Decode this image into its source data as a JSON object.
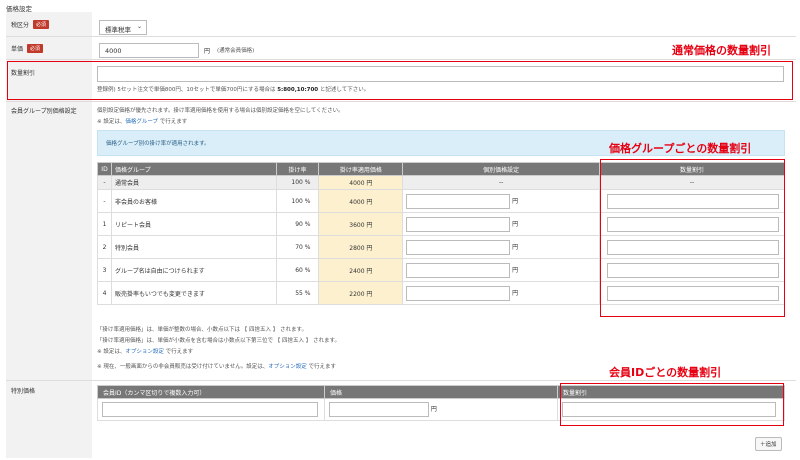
{
  "section_title": "価格設定",
  "tax": {
    "label": "税区分",
    "required": "必須",
    "value": "標準税率"
  },
  "price": {
    "label": "単価",
    "required": "必須",
    "value": "4000",
    "unit": "円",
    "note": "(通常会員価格)"
  },
  "qty": {
    "label": "数量割引",
    "hint_prefix": "登録例) 5セット注文で単価800円、10セットで単価700円にする場合は ",
    "hint_bold": "5:800,10:700",
    "hint_suffix": " と記述して下さい。"
  },
  "group": {
    "label": "会員グループ別価格設定",
    "desc": "個別設定価格が優先されます。掛け率適用価格を使用する場合は個別設定価格を空にしてください。",
    "note_prefix": "※ 設定は、",
    "note_link": "価格グループ",
    "note_suffix": " で行えます",
    "info": "価格グループ別の掛け率が適用されます。",
    "headers": [
      "ID",
      "価格グループ",
      "掛け率",
      "掛け率適用価格",
      "個別価格設定",
      "数量割引"
    ],
    "unit": "円",
    "rows": [
      {
        "id": "-",
        "name": "通常会員",
        "rate": "100 %",
        "price": "4000 円",
        "individual": "--",
        "discount": "--"
      },
      {
        "id": "-",
        "name": "非会員のお客様",
        "rate": "100 %",
        "price": "4000 円"
      },
      {
        "id": "1",
        "name": "リピート会員",
        "rate": "90 %",
        "price": "3600 円"
      },
      {
        "id": "2",
        "name": "特別会員",
        "rate": "70 %",
        "price": "2800 円"
      },
      {
        "id": "3",
        "name": "グループ名は自由につけられます",
        "rate": "60 %",
        "price": "2400 円"
      },
      {
        "id": "4",
        "name": "販売掛率もいつでも変更できます",
        "rate": "55 %",
        "price": "2200 円"
      }
    ],
    "foot1": "「掛け率適用価格」は、単価が整数の場合、小数点以下は 【 四捨五入 】 されます。",
    "foot2": "「掛け率適用価格」は、単価が小数点を含む場合は小数点以下第三位で 【 四捨五入 】 されます。",
    "foot3_prefix": "※ 設定は、",
    "foot3_link": "オプション設定",
    "foot3_suffix": " で行えます",
    "foot4_prefix": "※ 現在、一般画面からの非会員販売は受け付けていません。設定は、",
    "foot4_link": "オプション設定",
    "foot4_suffix": " で行えます"
  },
  "special": {
    "label": "特別価格",
    "headers": [
      "会員ID（カンマ区切りで複数入力可）",
      "価格",
      "数量割引"
    ],
    "unit": "円",
    "add": "＋追加"
  },
  "annotations": {
    "normal": "通常価格の数量割引",
    "group": "価格グループごとの数量割引",
    "member": "会員IDごとの数量割引",
    "color": "#e60012"
  }
}
